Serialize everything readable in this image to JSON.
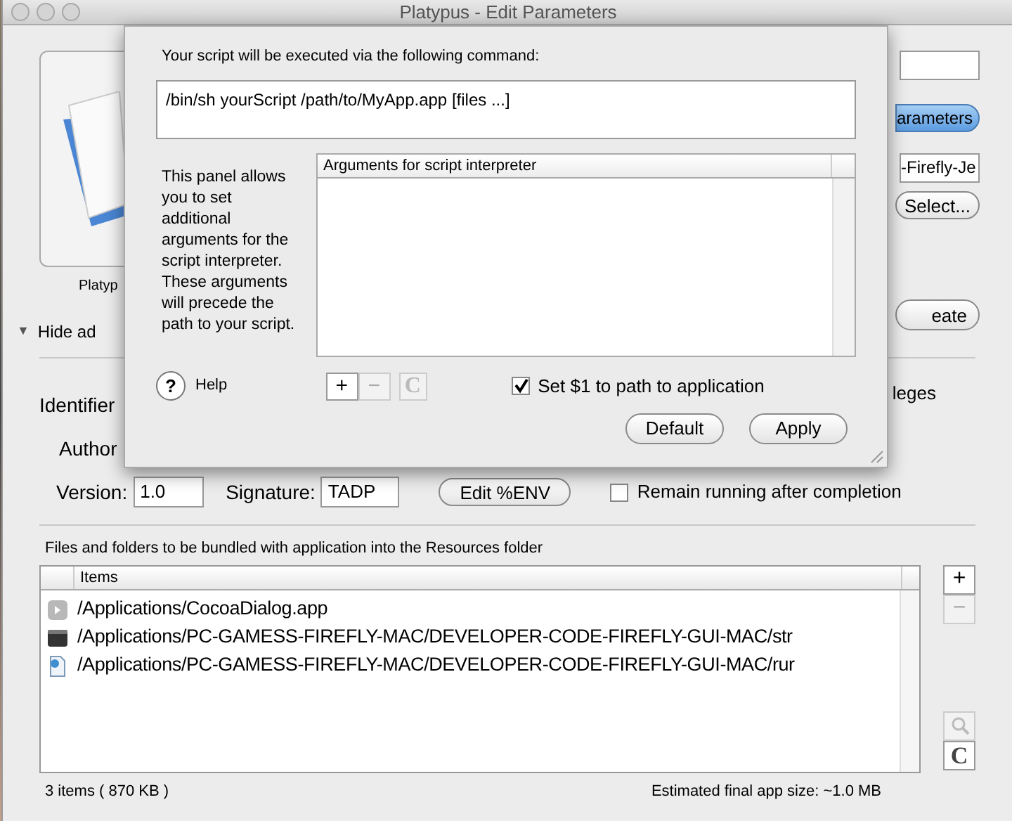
{
  "window": {
    "title": "Platypus - Edit Parameters"
  },
  "main": {
    "icon_label": "Platyp",
    "disclosure": {
      "icon": "▼",
      "label": "Hide ad",
      "expanded": true
    },
    "parameters_button": "arameters",
    "script_field": "-Firefly-Je",
    "select_button": "Select...",
    "create_button": "eate",
    "identifier_label": "Identifier",
    "privileges_label": "leges",
    "author_label": "Author",
    "version_label": "Version:",
    "version_value": "1.0",
    "signature_label": "Signature:",
    "signature_value": "TADP",
    "env_button": "Edit %ENV",
    "options": [
      {
        "label": "Remain running after completion",
        "checked": false
      }
    ],
    "files_label": "Files and folders to be bundled with application into the Resources folder",
    "files_header": "Items",
    "files": [
      {
        "kind": "app",
        "path": "/Applications/CocoaDialog.app"
      },
      {
        "kind": "exec",
        "path": "/Applications/PC-GAMESS-FIREFLY-MAC/DEVELOPER-CODE-FIREFLY-GUI-MAC/str"
      },
      {
        "kind": "script",
        "path": "/Applications/PC-GAMESS-FIREFLY-MAC/DEVELOPER-CODE-FIREFLY-GUI-MAC/rur"
      }
    ],
    "add_button": "+",
    "remove_button": "−",
    "clear_button": "C",
    "item_count": "3 items  ( 870 KB )",
    "app_size": "Estimated final app size: ~1.0 MB"
  },
  "sheet": {
    "command_label": "Your script will be executed via the following command:",
    "command": "/bin/sh yourScript /path/to/MyApp.app [files ...]",
    "description": "This panel allows you to set additional arguments for the script interpreter. These arguments will precede the path to your script.",
    "args_header": "Arguments for script interpreter",
    "help_button": "?",
    "help_label": "Help",
    "add_button": "+",
    "remove_button": "−",
    "clear_button": "C",
    "set_path": {
      "label": "Set $1 to path to application",
      "checked": true
    },
    "default_button": "Default",
    "apply_button": "Apply"
  }
}
